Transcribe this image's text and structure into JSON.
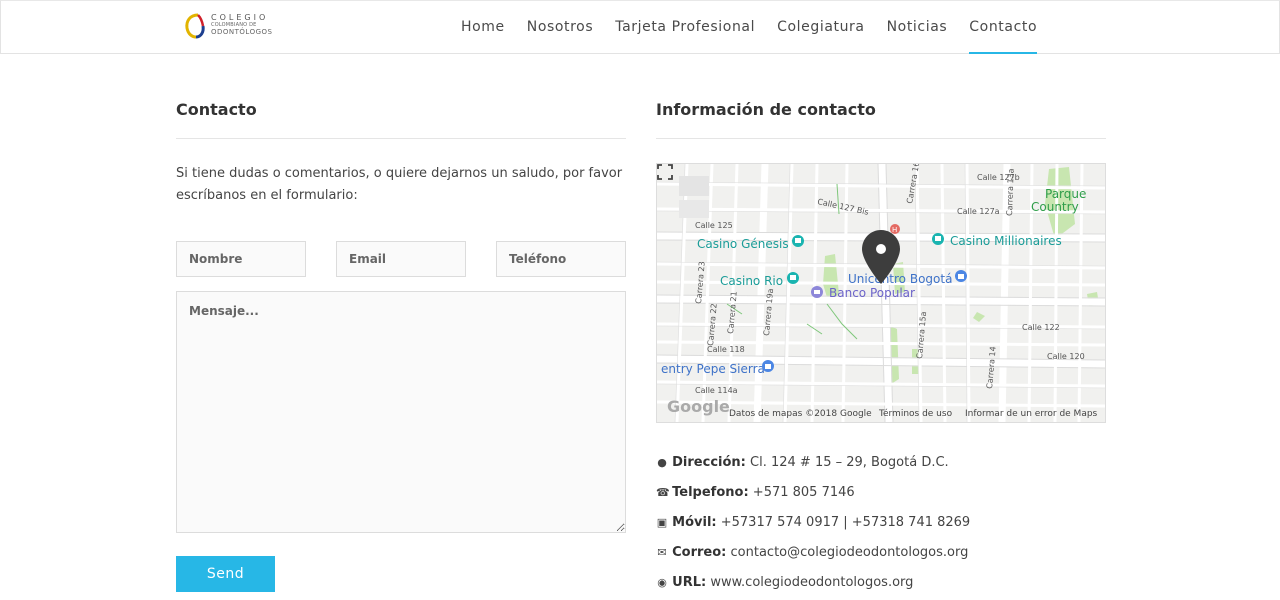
{
  "logo": {
    "line1": "COLEGIO",
    "line2": "COLOMBIANO DE",
    "line3": "ODONTÓLOGOS"
  },
  "nav": [
    {
      "label": "Home"
    },
    {
      "label": "Nosotros"
    },
    {
      "label": "Tarjeta Profesional"
    },
    {
      "label": "Colegiatura"
    },
    {
      "label": "Noticias"
    },
    {
      "label": "Contacto",
      "active": true
    }
  ],
  "contact": {
    "title": "Contacto",
    "intro": "Si tiene dudas o comentarios, o quiere dejarnos un saludo, por favor escríbanos en el formulario:",
    "name_placeholder": "Nombre",
    "email_placeholder": "Email",
    "phone_placeholder": "Teléfono",
    "message_placeholder": "Mensaje...",
    "send_label": "Send"
  },
  "info": {
    "title": "Información de contacto",
    "address_label": "Dirección:",
    "address_value": "Cl. 124 # 15 – 29, Bogotá D.C.",
    "phone_label": "Telpefono:",
    "phone_value": "+571 805 7146",
    "mobile_label": "Móvil:",
    "mobile_value": "+57317 574 0917 | +57318 741 8269",
    "email_label": "Correo:",
    "email_value": "contacto@colegiodeodontologos.org",
    "url_label": "URL:",
    "url_value": "www.colegiodeodontologos.org"
  },
  "map": {
    "labels": {
      "casino_genesis": "Casino Génesis",
      "casino_rio": "Casino Rio",
      "unicentro": "Unicentro Bogotá",
      "banco": "Banco Popular",
      "casino_millionaires": "Casino Millionaires",
      "parque1": "Parque",
      "parque2": "Country",
      "pepe": "entry Pepe Sierra",
      "c125": "Calle 125",
      "c127bis": "Calle 127 Bis",
      "c127b": "Calle 127b",
      "c127a": "Calle 127a",
      "c122": "Calle 122",
      "c120": "Calle 120",
      "c118": "Calle 118",
      "c114a": "Calle 114a",
      "k16": "Carrera 16",
      "k15a": "Carrera 15a",
      "k13a": "Carrera 13a",
      "k23": "Carrera 23",
      "k22": "Carrera 22",
      "k21": "Carrera 21",
      "k19a": "Carrera 19a",
      "k14": "Carrera 14"
    },
    "google": "Google",
    "data_credit": "Datos de mapas ©2018 Google",
    "terms": "Términos de uso",
    "report": "Informar de un error de Maps"
  },
  "colors": {
    "accent": "#27b7e6",
    "map_park": "#c8e6b0",
    "map_road": "#ffffff"
  }
}
